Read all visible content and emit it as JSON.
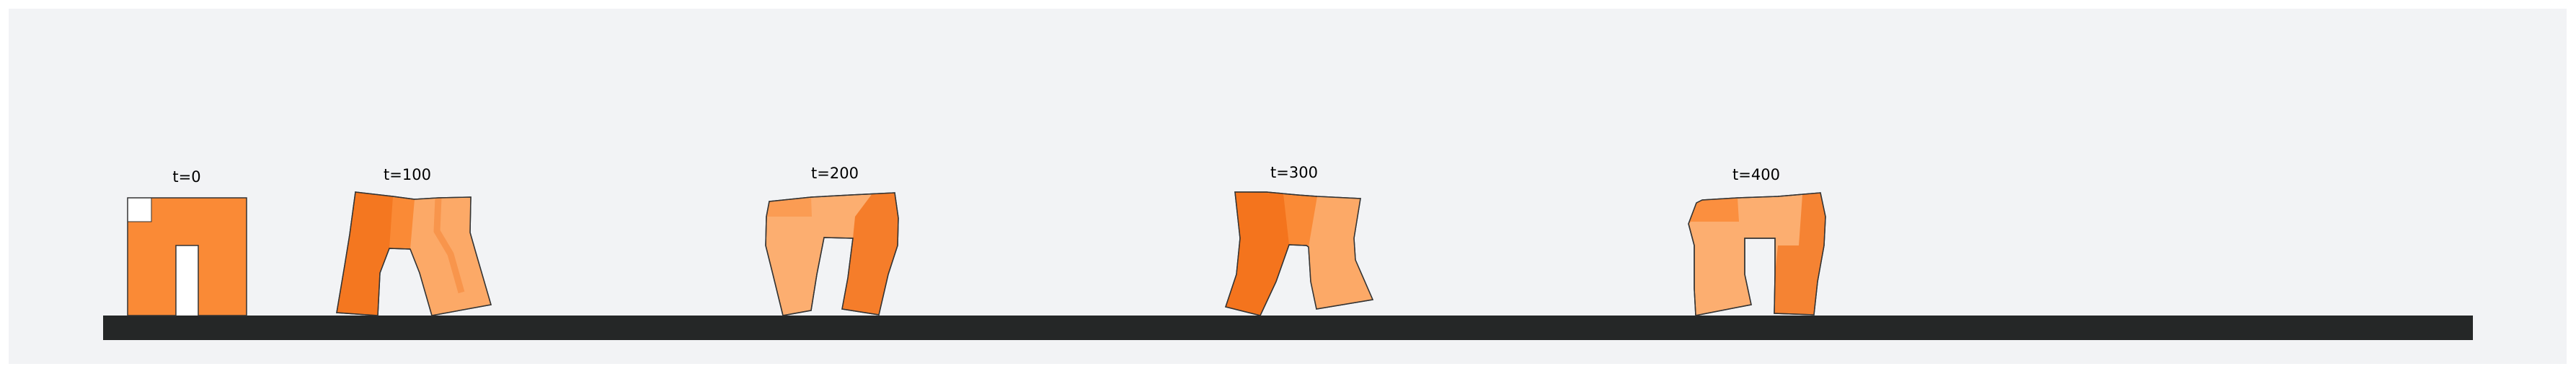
{
  "frames": [
    {
      "label": "t=0"
    },
    {
      "label": "t=100"
    },
    {
      "label": "t=200"
    },
    {
      "label": "t=300"
    },
    {
      "label": "t=400"
    }
  ],
  "colors": {
    "panel_background": "#f2f3f5",
    "ground": "#252727",
    "voxel_dark": "#f27019",
    "voxel_mid": "#fa8a36",
    "voxel_light": "#fcae70",
    "outline": "#333333"
  }
}
